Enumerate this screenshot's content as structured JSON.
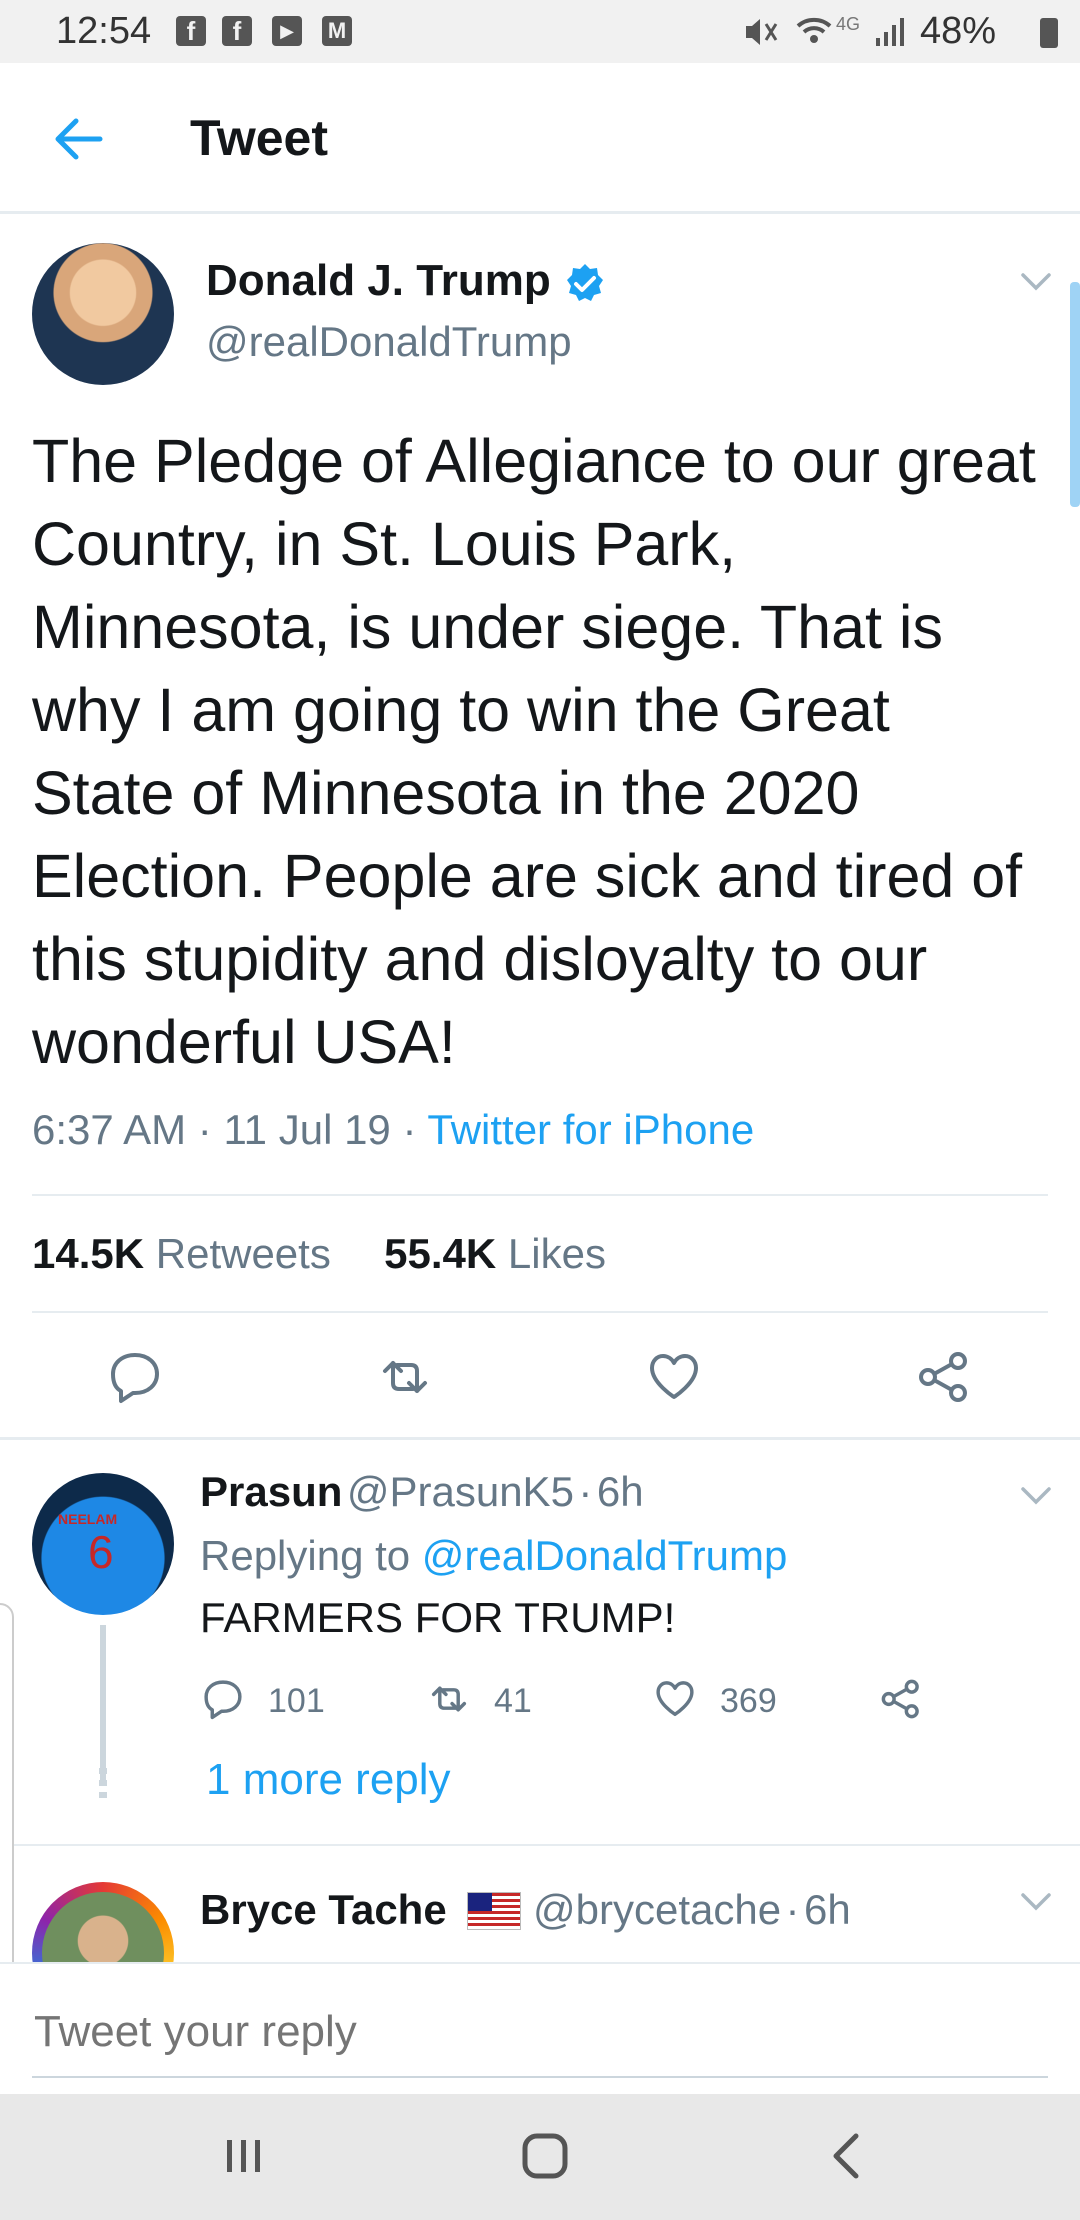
{
  "status_bar": {
    "time": "12:54",
    "network": "4G",
    "battery": "48%",
    "notification_icons": [
      "facebook-icon",
      "facebook-icon",
      "youtube-icon",
      "gmail-icon"
    ]
  },
  "header": {
    "title": "Tweet",
    "back_icon": "back-arrow-icon"
  },
  "tweet": {
    "author_name": "Donald J. Trump",
    "author_handle": "@realDonaldTrump",
    "verified": true,
    "text": "The Pledge of Allegiance to our great Country, in St. Louis Park, Minnesota, is under siege. That is why I am going to win the Great State of Minnesota in the 2020 Election. People are sick and tired of this stupidity and disloyalty to our wonderful USA!",
    "time": "6:37 AM",
    "date": "11 Jul 19",
    "source": "Twitter for iPhone",
    "retweets_count": "14.5K",
    "retweets_label": "Retweets",
    "likes_count": "55.4K",
    "likes_label": "Likes"
  },
  "replies": [
    {
      "name": "Prasun",
      "handle": "@PrasunK5",
      "age": "6h",
      "replying_prefix": "Replying to",
      "replying_to": "@realDonaldTrump",
      "text": "FARMERS FOR TRUMP!",
      "reply_count": "101",
      "retweet_count": "41",
      "like_count": "369",
      "more_replies": "1 more reply",
      "jersey_name": "NEELAM",
      "jersey_number": "6"
    },
    {
      "name": "Bryce Tache",
      "handle": "@brycetache",
      "age": "6h"
    }
  ],
  "composer": {
    "placeholder": "Tweet your reply"
  },
  "colors": {
    "accent": "#1da1f2",
    "secondary_text": "#657786",
    "divider": "#e6ecf0"
  }
}
